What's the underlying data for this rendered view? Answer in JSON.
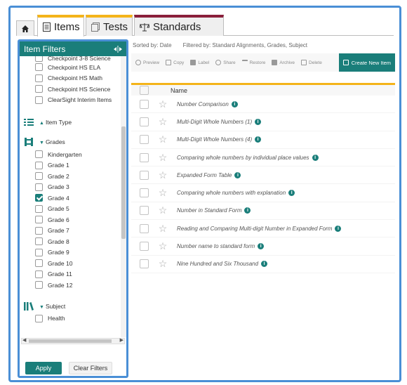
{
  "tabs": {
    "items": "Items",
    "tests": "Tests",
    "standards": "Standards"
  },
  "filters": {
    "title": "Item Filters",
    "assessments": [
      {
        "label": "Checkpoint 3-8 Science",
        "checked": false
      },
      {
        "label": "Checkpoint HS ELA",
        "checked": false
      },
      {
        "label": "Checkpoint HS Math",
        "checked": false
      },
      {
        "label": "Checkpoint HS Science",
        "checked": false
      },
      {
        "label": "ClearSight Interim Items",
        "checked": false
      }
    ],
    "item_type_label": "Item Type",
    "grades_label": "Grades",
    "grades": [
      {
        "label": "Kindergarten",
        "checked": false
      },
      {
        "label": "Grade 1",
        "checked": false
      },
      {
        "label": "Grade 2",
        "checked": false
      },
      {
        "label": "Grade 3",
        "checked": false
      },
      {
        "label": "Grade 4",
        "checked": true
      },
      {
        "label": "Grade 5",
        "checked": false
      },
      {
        "label": "Grade 6",
        "checked": false
      },
      {
        "label": "Grade 7",
        "checked": false
      },
      {
        "label": "Grade 8",
        "checked": false
      },
      {
        "label": "Grade 9",
        "checked": false
      },
      {
        "label": "Grade 10",
        "checked": false
      },
      {
        "label": "Grade 11",
        "checked": false
      },
      {
        "label": "Grade 12",
        "checked": false
      }
    ],
    "subject_label": "Subject",
    "subjects": [
      {
        "label": "Health",
        "checked": false
      }
    ],
    "apply_label": "Apply",
    "clear_label": "Clear Filters"
  },
  "main": {
    "sorted_by": "Sorted by: Date",
    "filtered_by": "Filtered by: Standard Alignments, Grades, Subject",
    "toolbar": [
      "Preview",
      "Copy",
      "Label",
      "Share",
      "Restore",
      "Archive",
      "Delete"
    ],
    "create_label": "Create New Item",
    "column_name": "Name",
    "rows": [
      "Number Comparison",
      "Multi-Digit Whole Numbers (1)",
      "Multi-Digit Whole Numbers (4)",
      "Comparing whole numbers by individual place values",
      "Expanded Form Table",
      "Comparing whole numbers with explanation",
      "Number in Standard Form",
      "Reading and Comparing Multi-digit Number in Expanded Form",
      "Number name to standard form",
      "Nine Hundred and Six Thousand"
    ]
  },
  "colors": {
    "teal": "#1a7e7a",
    "tab_yellow": "#f4b41a",
    "tab_maroon": "#8a1f3b",
    "highlight_blue": "#4a8fd6"
  }
}
